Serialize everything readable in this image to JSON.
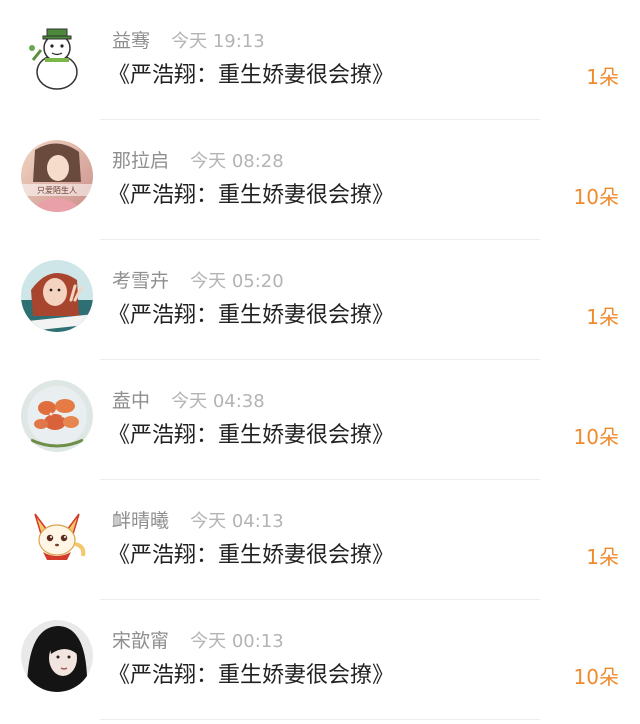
{
  "gift_list": [
    {
      "name": "益骞",
      "time": "今天 19:13",
      "gift": "《严浩翔：重生娇妻很会撩》",
      "count": "1朵",
      "avatar_icon": "snowman-avatar-icon"
    },
    {
      "name": "那拉启",
      "time": "今天 08:28",
      "gift": "《严浩翔：重生娇妻很会撩》",
      "count": "10朵",
      "avatar_icon": "girl-photo-avatar-icon",
      "avatar_text": "只爱陌生人"
    },
    {
      "name": "考雪卉",
      "time": "今天 05:20",
      "gift": "《严浩翔：重生娇妻很会撩》",
      "count": "1朵",
      "avatar_icon": "girl-peace-sign-avatar-icon"
    },
    {
      "name": "盍中",
      "time": "今天 04:38",
      "gift": "《严浩翔：重生娇妻很会撩》",
      "count": "10朵",
      "avatar_icon": "food-plate-avatar-icon"
    },
    {
      "name": "衅晴曦",
      "time": "今天 04:13",
      "gift": "《严浩翔：重生娇妻很会撩》",
      "count": "1朵",
      "avatar_icon": "cartoon-fox-avatar-icon"
    },
    {
      "name": "宋歆甯",
      "time": "今天 00:13",
      "gift": "《严浩翔：重生娇妻很会撩》",
      "count": "10朵",
      "avatar_icon": "girl-portrait-avatar-icon"
    }
  ],
  "colors": {
    "count": "#f08a2e",
    "name": "#8f8f8f",
    "time": "#b4b4b4",
    "gift": "#222222",
    "divider": "#eeeeee"
  }
}
